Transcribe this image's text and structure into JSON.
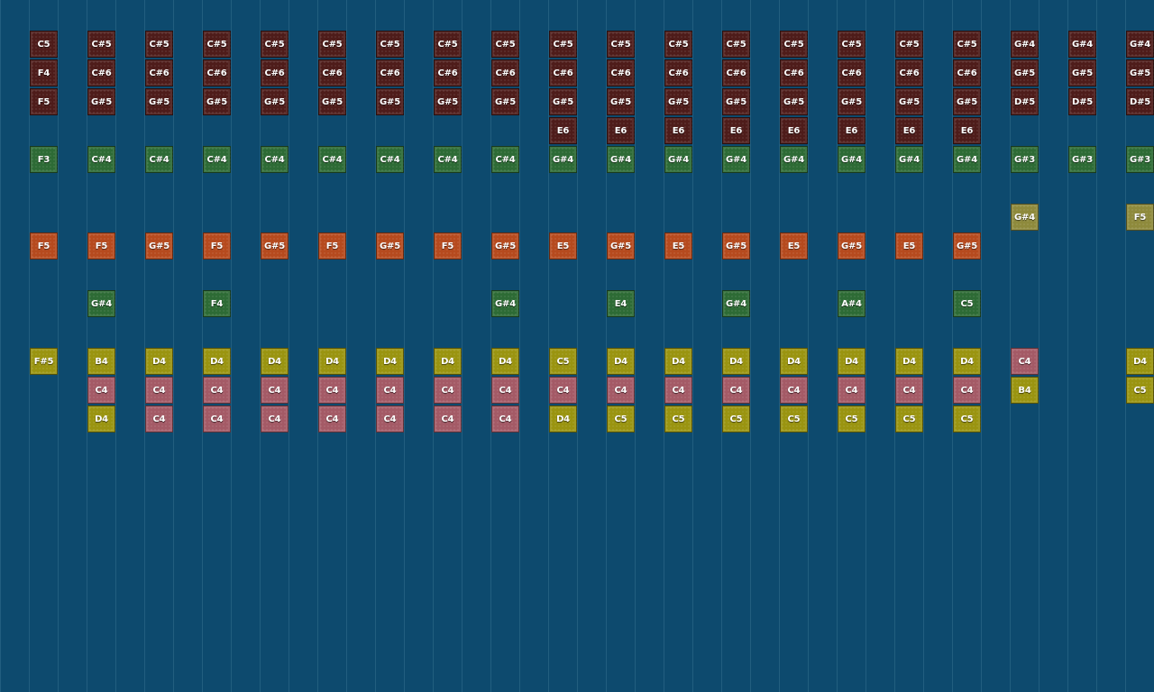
{
  "colors": {
    "background": "#0d4a6e",
    "gridline": "#2a6585",
    "dark-red": "#4e1c1a",
    "green": "#2d6b35",
    "orange": "#b64a1e",
    "yellow": "#9a9410",
    "pink": "#a45a66",
    "khaki": "#8e8a3c"
  },
  "columns": [
    [
      [
        "C5",
        "dark-red"
      ],
      [
        "F4",
        "dark-red"
      ],
      [
        "F5",
        "dark-red"
      ],
      null,
      [
        "F3",
        "green"
      ],
      null,
      null,
      [
        "F5",
        "orange"
      ],
      null,
      null,
      null,
      [
        "F#5",
        "yellow"
      ],
      null,
      null
    ],
    [
      [
        "C#5",
        "dark-red"
      ],
      [
        "C#6",
        "dark-red"
      ],
      [
        "G#5",
        "dark-red"
      ],
      null,
      [
        "C#4",
        "green"
      ],
      null,
      null,
      [
        "F5",
        "orange"
      ],
      null,
      [
        "G#4",
        "green"
      ],
      null,
      [
        "B4",
        "yellow"
      ],
      [
        "C4",
        "pink"
      ],
      [
        "D4",
        "yellow"
      ]
    ],
    [
      [
        "C#5",
        "dark-red"
      ],
      [
        "C#6",
        "dark-red"
      ],
      [
        "G#5",
        "dark-red"
      ],
      null,
      [
        "C#4",
        "green"
      ],
      null,
      null,
      [
        "G#5",
        "orange"
      ],
      null,
      null,
      null,
      [
        "D4",
        "yellow"
      ],
      [
        "C4",
        "pink"
      ],
      [
        "C4",
        "pink"
      ]
    ],
    [
      [
        "C#5",
        "dark-red"
      ],
      [
        "C#6",
        "dark-red"
      ],
      [
        "G#5",
        "dark-red"
      ],
      null,
      [
        "C#4",
        "green"
      ],
      null,
      null,
      [
        "F5",
        "orange"
      ],
      null,
      [
        "F4",
        "green"
      ],
      null,
      [
        "D4",
        "yellow"
      ],
      [
        "C4",
        "pink"
      ],
      [
        "C4",
        "pink"
      ]
    ],
    [
      [
        "C#5",
        "dark-red"
      ],
      [
        "C#6",
        "dark-red"
      ],
      [
        "G#5",
        "dark-red"
      ],
      null,
      [
        "C#4",
        "green"
      ],
      null,
      null,
      [
        "G#5",
        "orange"
      ],
      null,
      null,
      null,
      [
        "D4",
        "yellow"
      ],
      [
        "C4",
        "pink"
      ],
      [
        "C4",
        "pink"
      ]
    ],
    [
      [
        "C#5",
        "dark-red"
      ],
      [
        "C#6",
        "dark-red"
      ],
      [
        "G#5",
        "dark-red"
      ],
      null,
      [
        "C#4",
        "green"
      ],
      null,
      null,
      [
        "F5",
        "orange"
      ],
      null,
      null,
      null,
      [
        "D4",
        "yellow"
      ],
      [
        "C4",
        "pink"
      ],
      [
        "C4",
        "pink"
      ]
    ],
    [
      [
        "C#5",
        "dark-red"
      ],
      [
        "C#6",
        "dark-red"
      ],
      [
        "G#5",
        "dark-red"
      ],
      null,
      [
        "C#4",
        "green"
      ],
      null,
      null,
      [
        "G#5",
        "orange"
      ],
      null,
      null,
      null,
      [
        "D4",
        "yellow"
      ],
      [
        "C4",
        "pink"
      ],
      [
        "C4",
        "pink"
      ]
    ],
    [
      [
        "C#5",
        "dark-red"
      ],
      [
        "C#6",
        "dark-red"
      ],
      [
        "G#5",
        "dark-red"
      ],
      null,
      [
        "C#4",
        "green"
      ],
      null,
      null,
      [
        "F5",
        "orange"
      ],
      null,
      null,
      null,
      [
        "D4",
        "yellow"
      ],
      [
        "C4",
        "pink"
      ],
      [
        "C4",
        "pink"
      ]
    ],
    [
      [
        "C#5",
        "dark-red"
      ],
      [
        "C#6",
        "dark-red"
      ],
      [
        "G#5",
        "dark-red"
      ],
      null,
      [
        "C#4",
        "green"
      ],
      null,
      null,
      [
        "G#5",
        "orange"
      ],
      null,
      [
        "G#4",
        "green"
      ],
      null,
      [
        "D4",
        "yellow"
      ],
      [
        "C4",
        "pink"
      ],
      [
        "C4",
        "pink"
      ]
    ],
    [
      [
        "C#5",
        "dark-red"
      ],
      [
        "C#6",
        "dark-red"
      ],
      [
        "G#5",
        "dark-red"
      ],
      [
        "E6",
        "dark-red"
      ],
      [
        "G#4",
        "green"
      ],
      null,
      null,
      [
        "E5",
        "orange"
      ],
      null,
      null,
      null,
      [
        "C5",
        "yellow"
      ],
      [
        "C4",
        "pink"
      ],
      [
        "D4",
        "yellow"
      ]
    ],
    [
      [
        "C#5",
        "dark-red"
      ],
      [
        "C#6",
        "dark-red"
      ],
      [
        "G#5",
        "dark-red"
      ],
      [
        "E6",
        "dark-red"
      ],
      [
        "G#4",
        "green"
      ],
      null,
      null,
      [
        "G#5",
        "orange"
      ],
      null,
      [
        "E4",
        "green"
      ],
      null,
      [
        "D4",
        "yellow"
      ],
      [
        "C4",
        "pink"
      ],
      [
        "C5",
        "yellow"
      ]
    ],
    [
      [
        "C#5",
        "dark-red"
      ],
      [
        "C#6",
        "dark-red"
      ],
      [
        "G#5",
        "dark-red"
      ],
      [
        "E6",
        "dark-red"
      ],
      [
        "G#4",
        "green"
      ],
      null,
      null,
      [
        "E5",
        "orange"
      ],
      null,
      null,
      null,
      [
        "D4",
        "yellow"
      ],
      [
        "C4",
        "pink"
      ],
      [
        "C5",
        "yellow"
      ]
    ],
    [
      [
        "C#5",
        "dark-red"
      ],
      [
        "C#6",
        "dark-red"
      ],
      [
        "G#5",
        "dark-red"
      ],
      [
        "E6",
        "dark-red"
      ],
      [
        "G#4",
        "green"
      ],
      null,
      null,
      [
        "G#5",
        "orange"
      ],
      null,
      [
        "G#4",
        "green"
      ],
      null,
      [
        "D4",
        "yellow"
      ],
      [
        "C4",
        "pink"
      ],
      [
        "C5",
        "yellow"
      ]
    ],
    [
      [
        "C#5",
        "dark-red"
      ],
      [
        "C#6",
        "dark-red"
      ],
      [
        "G#5",
        "dark-red"
      ],
      [
        "E6",
        "dark-red"
      ],
      [
        "G#4",
        "green"
      ],
      null,
      null,
      [
        "E5",
        "orange"
      ],
      null,
      null,
      null,
      [
        "D4",
        "yellow"
      ],
      [
        "C4",
        "pink"
      ],
      [
        "C5",
        "yellow"
      ]
    ],
    [
      [
        "C#5",
        "dark-red"
      ],
      [
        "C#6",
        "dark-red"
      ],
      [
        "G#5",
        "dark-red"
      ],
      [
        "E6",
        "dark-red"
      ],
      [
        "G#4",
        "green"
      ],
      null,
      null,
      [
        "G#5",
        "orange"
      ],
      null,
      [
        "A#4",
        "green"
      ],
      null,
      [
        "D4",
        "yellow"
      ],
      [
        "C4",
        "pink"
      ],
      [
        "C5",
        "yellow"
      ]
    ],
    [
      [
        "C#5",
        "dark-red"
      ],
      [
        "C#6",
        "dark-red"
      ],
      [
        "G#5",
        "dark-red"
      ],
      [
        "E6",
        "dark-red"
      ],
      [
        "G#4",
        "green"
      ],
      null,
      null,
      [
        "E5",
        "orange"
      ],
      null,
      null,
      null,
      [
        "D4",
        "yellow"
      ],
      [
        "C4",
        "pink"
      ],
      [
        "C5",
        "yellow"
      ]
    ],
    [
      [
        "C#5",
        "dark-red"
      ],
      [
        "C#6",
        "dark-red"
      ],
      [
        "G#5",
        "dark-red"
      ],
      [
        "E6",
        "dark-red"
      ],
      [
        "G#4",
        "green"
      ],
      null,
      null,
      [
        "G#5",
        "orange"
      ],
      null,
      [
        "C5",
        "green"
      ],
      null,
      [
        "D4",
        "yellow"
      ],
      [
        "C4",
        "pink"
      ],
      [
        "C5",
        "yellow"
      ]
    ],
    [
      [
        "G#4",
        "dark-red"
      ],
      [
        "G#5",
        "dark-red"
      ],
      [
        "D#5",
        "dark-red"
      ],
      null,
      [
        "G#3",
        "green"
      ],
      null,
      [
        "G#4",
        "khaki"
      ],
      null,
      null,
      null,
      null,
      [
        "C4",
        "pink"
      ],
      [
        "B4",
        "yellow"
      ],
      null
    ],
    [
      [
        "G#4",
        "dark-red"
      ],
      [
        "G#5",
        "dark-red"
      ],
      [
        "D#5",
        "dark-red"
      ],
      null,
      [
        "G#3",
        "green"
      ],
      null,
      null,
      null,
      null,
      null,
      null,
      null,
      null,
      null
    ],
    [
      [
        "G#4",
        "dark-red"
      ],
      [
        "G#5",
        "dark-red"
      ],
      [
        "D#5",
        "dark-red"
      ],
      null,
      [
        "G#3",
        "green"
      ],
      null,
      [
        "F5",
        "khaki"
      ],
      null,
      null,
      null,
      null,
      [
        "D4",
        "yellow"
      ],
      [
        "C5",
        "yellow"
      ],
      null
    ]
  ]
}
